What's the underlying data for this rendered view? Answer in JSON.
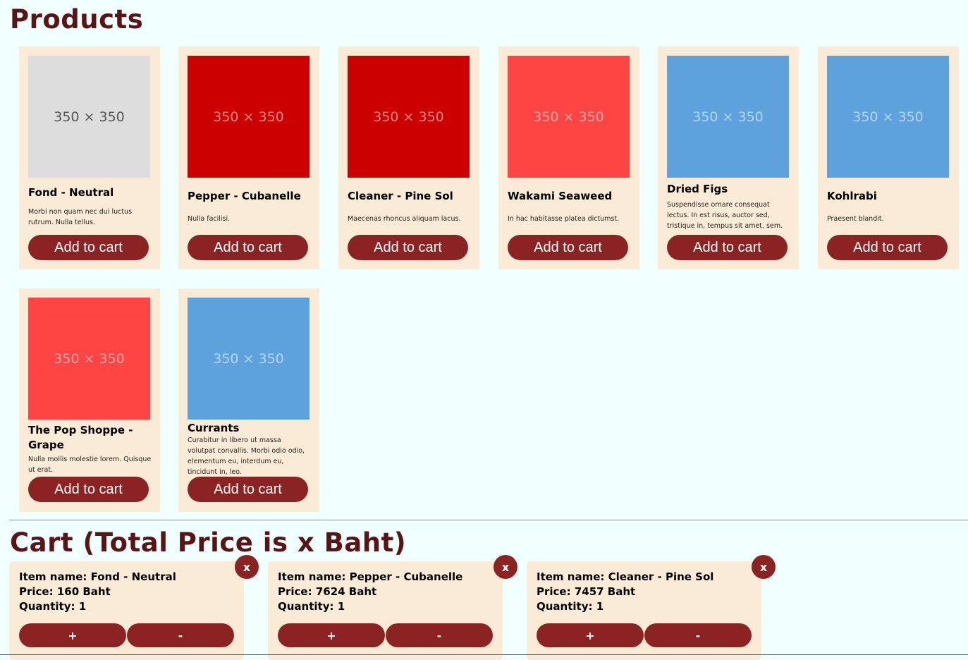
{
  "products_title": "Products",
  "cart_title": "Cart (Total Price is x Baht)",
  "products": [
    {
      "name": "Fond - Neutral",
      "description": "Morbi non quam nec dui luctus rutrum. Nulla tellus.",
      "image_label": "350 × 350",
      "image_color": "#dddddd",
      "image_text_color": "#555555",
      "button_label": "Add to cart"
    },
    {
      "name": "Pepper - Cubanelle",
      "description": "Nulla facilisi.",
      "image_label": "350 × 350",
      "image_color": "#cc0000",
      "image_text_color": "#e88a8a",
      "button_label": "Add to cart"
    },
    {
      "name": "Cleaner - Pine Sol",
      "description": "Maecenas rhoncus aliquam lacus.",
      "image_label": "350 × 350",
      "image_color": "#cc0000",
      "image_text_color": "#e88a8a",
      "button_label": "Add to cart"
    },
    {
      "name": "Wakami Seaweed",
      "description": "In hac habitasse platea dictumst.",
      "image_label": "350 × 350",
      "image_color": "#ff4444",
      "image_text_color": "#ffaaaa",
      "button_label": "Add to cart"
    },
    {
      "name": "Dried Figs",
      "description": "Suspendisse ornare consequat lectus. In est risus, auctor sed, tristique in, tempus sit amet, sem.",
      "image_label": "350 × 350",
      "image_color": "#5da2dc",
      "image_text_color": "#b6d6f0",
      "button_label": "Add to cart"
    },
    {
      "name": "Kohlrabi",
      "description": "Praesent blandit.",
      "image_label": "350 × 350",
      "image_color": "#5da2dc",
      "image_text_color": "#b6d6f0",
      "button_label": "Add to cart"
    },
    {
      "name": "The Pop Shoppe - Grape",
      "description": "Nulla mollis molestie lorem. Quisque ut erat.",
      "image_label": "350 × 350",
      "image_color": "#ff4444",
      "image_text_color": "#ffaaaa",
      "button_label": "Add to cart"
    },
    {
      "name": "Currants",
      "description": "Curabitur in libero ut massa volutpat convallis. Morbi odio odio, elementum eu, interdum eu, tincidunt in, leo.",
      "image_label": "350 × 350",
      "image_color": "#5da2dc",
      "image_text_color": "#b6d6f0",
      "button_label": "Add to cart"
    }
  ],
  "cart": [
    {
      "name_line": "Item name: Fond - Neutral",
      "price_line": "Price: 160 Baht",
      "qty_line": "Quantity: 1",
      "plus": "+",
      "minus": "-",
      "remove": "x"
    },
    {
      "name_line": "Item name: Pepper - Cubanelle",
      "price_line": "Price: 7624 Baht",
      "qty_line": "Quantity: 1",
      "plus": "+",
      "minus": "-",
      "remove": "x"
    },
    {
      "name_line": "Item name: Cleaner - Pine Sol",
      "price_line": "Price: 7457 Baht",
      "qty_line": "Quantity: 1",
      "plus": "+",
      "minus": "-",
      "remove": "x"
    }
  ],
  "colors": {
    "accent": "#8b2323",
    "card_bg": "#faebd7",
    "page_bg": "#f0ffff",
    "heading": "#5a1414"
  }
}
